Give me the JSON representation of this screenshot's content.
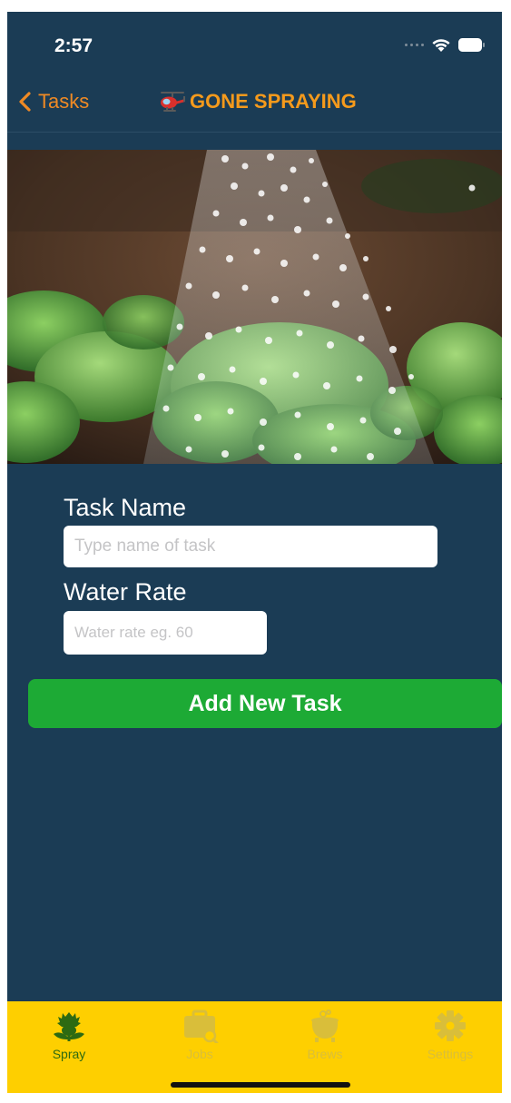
{
  "status_bar": {
    "time": "2:57"
  },
  "nav": {
    "back_label": "Tasks",
    "title": "GONE SPRAYING"
  },
  "form": {
    "task_name_label": "Task Name",
    "task_name_placeholder": "Type name of task",
    "task_name_value": "",
    "water_rate_label": "Water Rate",
    "water_rate_placeholder": "Water rate eg. 60",
    "water_rate_value": "",
    "add_button_label": "Add New Task"
  },
  "tab_bar": {
    "tabs": [
      {
        "label": "Spray",
        "icon": "thistle-icon",
        "active": true
      },
      {
        "label": "Jobs",
        "icon": "briefcase-icon",
        "active": false
      },
      {
        "label": "Brews",
        "icon": "cauldron-icon",
        "active": false
      },
      {
        "label": "Settings",
        "icon": "gear-icon",
        "active": false
      }
    ]
  },
  "colors": {
    "background": "#1b3c55",
    "accent_orange": "#f59a1c",
    "button_green": "#1daa35",
    "tab_bar_yellow": "#fecf00",
    "tab_active": "#2d6a12",
    "tab_inactive": "#d9be3a"
  }
}
